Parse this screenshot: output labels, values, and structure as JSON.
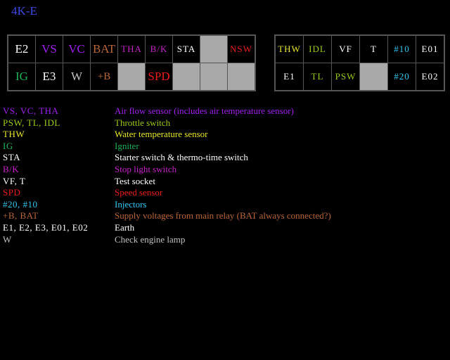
{
  "title": "4K-E",
  "colors": {
    "background": "#000000",
    "blank_cell": "#a9a9a9",
    "title": "#3f48e6",
    "purple": "#a020f0",
    "magenta": "#c623c6",
    "yellowgreen": "#9ccc1c",
    "yellow": "#e6e62d",
    "green": "#20b25a",
    "white": "#ffffff",
    "red": "#ee1c1c",
    "cyan": "#33c8f0",
    "brown": "#b8663a"
  },
  "left_connector": {
    "row1": [
      "E2",
      "VS",
      "VC",
      "BAT",
      "THA",
      "B/K",
      "STA",
      "",
      "NSW"
    ],
    "row2": [
      "IG",
      "E3",
      "W",
      "+B",
      "",
      "SPD",
      "",
      "",
      ""
    ]
  },
  "right_connector": {
    "row1": [
      "THW",
      "IDL",
      "VF",
      "T",
      "#10",
      "E01"
    ],
    "row2": [
      "E1",
      "TL",
      "PSW",
      "",
      "#20",
      "E02"
    ]
  },
  "legend": [
    {
      "code": "VS, VC, THA",
      "desc": "Air flow sensor (includes air temperature sensor)"
    },
    {
      "code": "PSW, TL, IDL",
      "desc": "Throttle switch"
    },
    {
      "code": "THW",
      "desc": "Water temperature sensor"
    },
    {
      "code": "IG",
      "desc": "Igniter"
    },
    {
      "code": "STA",
      "desc": "Starter switch & thermo-time switch"
    },
    {
      "code": "B/K",
      "desc": "Stop light switch"
    },
    {
      "code": "VF, T",
      "desc": "Test socket"
    },
    {
      "code": "SPD",
      "desc": "Speed sensor"
    },
    {
      "code": "#20, #10",
      "desc": "Injectors"
    },
    {
      "code": "+B, BAT",
      "desc": "Supply voltages from main relay (BAT always connected?)"
    },
    {
      "code": "E1, E2, E3, E01, E02",
      "desc": "Earth"
    },
    {
      "code": "W",
      "desc": "Check engine lamp"
    }
  ]
}
